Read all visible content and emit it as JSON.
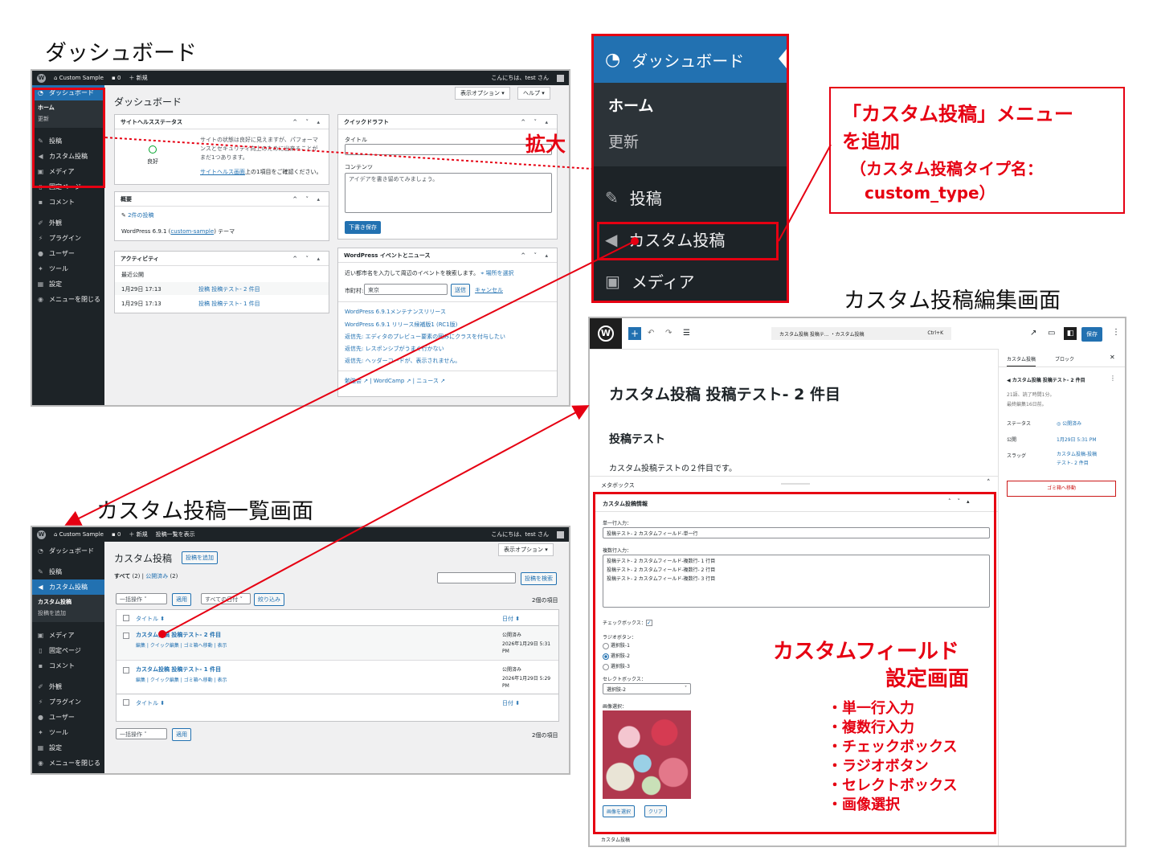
{
  "captions": {
    "dashboard": "ダッシュボード",
    "list": "カスタム投稿一覧画面",
    "editor": "カスタム投稿編集画面",
    "zoom": "拡大",
    "callout": [
      "「カスタム投稿」メニュー",
      "を追加",
      "（カスタム投稿タイプ名：",
      "custom_type）"
    ],
    "cf_title": [
      "カスタムフィールド",
      "設定画面"
    ],
    "cf_list": [
      "・単一行入力",
      "・複数行入力",
      "・チェックボックス",
      "・ラジオボタン",
      "・セレクトボックス",
      "・画像選択"
    ]
  },
  "adminbar": {
    "site": "Custom Sample",
    "comments": "0",
    "new": "＋ 新規",
    "view_list": "投稿一覧を表示",
    "greeting": "こんにちは、test さん"
  },
  "menu": {
    "dashboard": "ダッシュボード",
    "home": "ホーム",
    "update": "更新",
    "posts": "投稿",
    "custom": "カスタム投稿",
    "media": "メディア",
    "pages": "固定ページ",
    "comments": "コメント",
    "appearance": "外観",
    "plugins": "プラグイン",
    "users": "ユーザー",
    "tools": "ツール",
    "settings": "設定",
    "collapse": "メニューを閉じる",
    "custom_list": "カスタム投稿",
    "custom_add": "投稿を追加"
  },
  "dashboard": {
    "title": "ダッシュボード",
    "screen_options": "表示オプション ▾",
    "help": "ヘルプ ▾",
    "site_health": {
      "title": "サイトヘルスステータス",
      "status": "良好",
      "text1": "サイトの状態は良好に見えますが、パフォーマ",
      "text2": "ンスとセキュリティ向上のために出来ることが",
      "text3": "まだ1つあります。",
      "link": "サイトヘルス画面",
      "link_rest": "上の1項目をご確認ください。"
    },
    "overview": {
      "title": "概要",
      "posts": "2件の投稿",
      "version_prefix": "WordPress 6.9.1 (",
      "theme": "custom-sample",
      "version_suffix": ") テーマ"
    },
    "activity": {
      "title": "アクティビティ",
      "recent": "最近公開",
      "rows": [
        {
          "date": "1月29日 17:13",
          "title": "投稿 投稿テスト- 2 件目"
        },
        {
          "date": "1月29日 17:13",
          "title": "投稿 投稿テスト- 1 件目"
        }
      ]
    },
    "quick_draft": {
      "title": "クイックドラフト",
      "title_label": "タイトル",
      "content_label": "コンテンツ",
      "placeholder": "アイデアを書き留めてみましょう。",
      "save": "下書き保存"
    },
    "events": {
      "title": "WordPress イベントとニュース",
      "intro": "近い都市名を入力して周辺のイベントを検索します。",
      "pick": "場所を選択",
      "city_label": "市町村:",
      "city": "東京",
      "send": "送信",
      "cancel": "キャンセル",
      "news": [
        "WordPress 6.9.1メンテナンスリリース",
        "WordPress 6.9.1 リリース候補版1 (RC1版)",
        "返信先: エディタのプレビュー要素の囲みにクラスを付与したい",
        "返信先: レスポンシブがうまく行かない",
        "返信先: ヘッダーコードが、表示されません。"
      ],
      "footer": [
        "勉強会",
        "WordCamp",
        "ニュース"
      ]
    }
  },
  "list": {
    "title": "カスタム投稿",
    "add": "投稿を追加",
    "screen_options": "表示オプション ▾",
    "filter_all": "すべて",
    "filter_all_count": "(2)",
    "filter_pub": "公開済み",
    "filter_pub_count": "(2)",
    "search_btn": "投稿を検索",
    "bulk": "一括操作",
    "apply": "適用",
    "dates": "すべての日付",
    "filter": "絞り込み",
    "count": "2個の項目",
    "col_title": "タイトル ⬍",
    "col_date": "日付 ⬍",
    "actions": "編集 | クイック編集 | ゴミ箱へ移動 | 表示",
    "rows": [
      {
        "title": "カスタム投稿 投稿テスト- 2 件目",
        "status": "公開済み",
        "date": "2026年1月29日 5:31",
        "ampm": "PM"
      },
      {
        "title": "カスタム投稿 投稿テスト- 1 件目",
        "status": "公開済み",
        "date": "2026年1月29日 5:29",
        "ampm": "PM"
      }
    ]
  },
  "editor": {
    "doc_title": "カスタム投稿 投稿テ... ・カスタム投稿",
    "shortcut": "Ctrl+K",
    "save": "保存",
    "post_title": "カスタム投稿 投稿テスト- 2 件目",
    "heading": "投稿テスト",
    "paragraph": "カスタム投稿テストの２件目です。",
    "metabox": "メタボックス",
    "cf_box_title": "カスタム投稿情報",
    "single_label": "単一行入力：",
    "single_value": "投稿テスト- 2 カスタムフィールド-単一行",
    "multi_label": "複数行入力：",
    "multi_lines": [
      "投稿テスト- 2 カスタムフィールド-複数行- 1 行目",
      "投稿テスト- 2 カスタムフィールド-複数行- 2 行目",
      "投稿テスト- 2 カスタムフィールド-複数行- 3 行目"
    ],
    "checkbox_label": "チェックボックス：",
    "radio_label": "ラジオボタン：",
    "radios": [
      "選択肢-1",
      "選択肢-2",
      "選択肢-3"
    ],
    "radio_selected": 1,
    "select_label": "セレクトボックス：",
    "select_value": "選択肢-2",
    "image_label": "画像選択：",
    "image_btn": "画像を選択",
    "clear_btn": "クリア",
    "footer": "カスタム投稿",
    "sidebar": {
      "tab_post": "カスタム投稿",
      "tab_block": "ブロック",
      "name": "カスタム投稿 投稿テスト- 2 件目",
      "meta1": "21語、読了時間1分。",
      "meta2": "最終編集16日前。",
      "status_label": "ステータス",
      "status": "公開済み",
      "publish_label": "公開",
      "publish": "1月29日 5:31 PM",
      "slug_label": "スラッグ",
      "slug1": "カスタム投稿-投稿",
      "slug2": "テスト- 2 件目",
      "trash": "ゴミ箱へ移動"
    }
  },
  "colors": {
    "accent": "#2271b1",
    "red": "#e60012",
    "admin_dark": "#1d2327"
  }
}
